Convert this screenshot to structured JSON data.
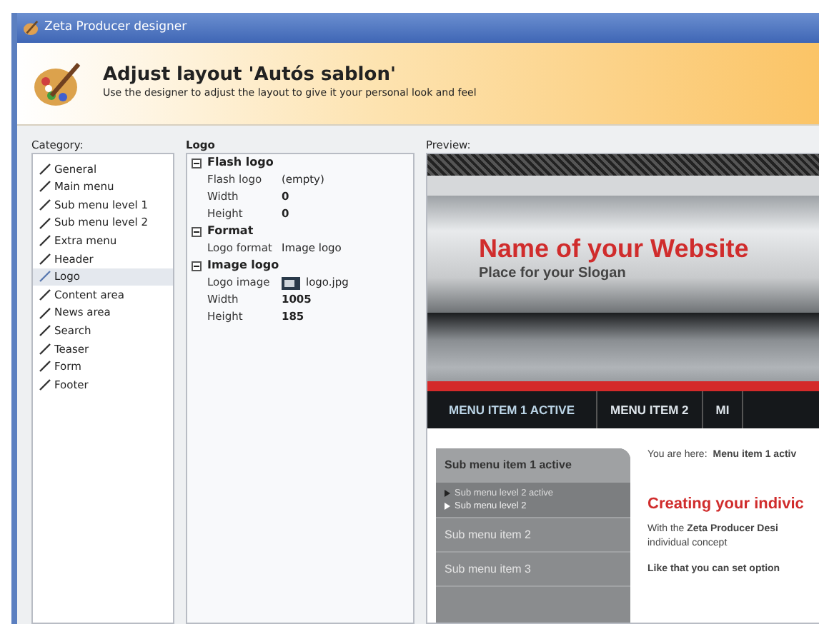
{
  "window": {
    "title": "Zeta Producer designer"
  },
  "header": {
    "title": "Adjust layout 'Autós sablon'",
    "subtitle": "Use the designer to adjust the layout to give it your personal look and feel"
  },
  "category": {
    "label": "Category:",
    "items": [
      {
        "label": "General",
        "selected": false
      },
      {
        "label": "Main menu",
        "selected": false
      },
      {
        "label": "Sub menu level 1",
        "selected": false
      },
      {
        "label": "Sub menu level 2",
        "selected": false
      },
      {
        "label": "Extra menu",
        "selected": false
      },
      {
        "label": "Header",
        "selected": false
      },
      {
        "label": "Logo",
        "selected": true
      },
      {
        "label": "Content area",
        "selected": false
      },
      {
        "label": "News area",
        "selected": false
      },
      {
        "label": "Search",
        "selected": false
      },
      {
        "label": "Teaser",
        "selected": false
      },
      {
        "label": "Form",
        "selected": false
      },
      {
        "label": "Footer",
        "selected": false
      }
    ]
  },
  "properties": {
    "title": "Logo",
    "groups": [
      {
        "name": "Flash logo",
        "expanded": true,
        "rows": [
          {
            "name": "Flash logo",
            "value": "(empty)",
            "kind": "text"
          },
          {
            "name": "Width",
            "value": "0",
            "kind": "bold"
          },
          {
            "name": "Height",
            "value": "0",
            "kind": "bold"
          }
        ]
      },
      {
        "name": "Format",
        "expanded": true,
        "rows": [
          {
            "name": "Logo format",
            "value": "Image logo",
            "kind": "text"
          }
        ]
      },
      {
        "name": "Image logo",
        "expanded": true,
        "rows": [
          {
            "name": "Logo image",
            "value": "logo.jpg",
            "kind": "image"
          },
          {
            "name": "Width",
            "value": "1005",
            "kind": "bold"
          },
          {
            "name": "Height",
            "value": "185",
            "kind": "bold"
          }
        ]
      }
    ]
  },
  "preview": {
    "label": "Preview:",
    "site_name": "Name of your Website",
    "slogan": "Place for your Slogan",
    "menu": [
      {
        "label": "MENU ITEM 1 ACTIVE",
        "selected": true
      },
      {
        "label": "MENU ITEM 2",
        "selected": false
      },
      {
        "label": "MI",
        "selected": false
      }
    ],
    "submenu": [
      {
        "label": "Sub menu item 1 active",
        "selected": true,
        "children": [
          {
            "label": "Sub menu level 2 active",
            "selected": true
          },
          {
            "label": "Sub menu level 2",
            "selected": false
          }
        ]
      },
      {
        "label": "Sub menu item 2",
        "selected": false
      },
      {
        "label": "Sub menu item 3",
        "selected": false
      }
    ],
    "breadcrumb": {
      "prefix": "You are here:",
      "link": "Menu item 1 activ"
    },
    "heading": "Creating your indivic",
    "paragraph_lines": [
      "With the **Zeta Producer Desi**",
      "individual concept"
    ],
    "paragraph_2": "Like that you can set option"
  }
}
